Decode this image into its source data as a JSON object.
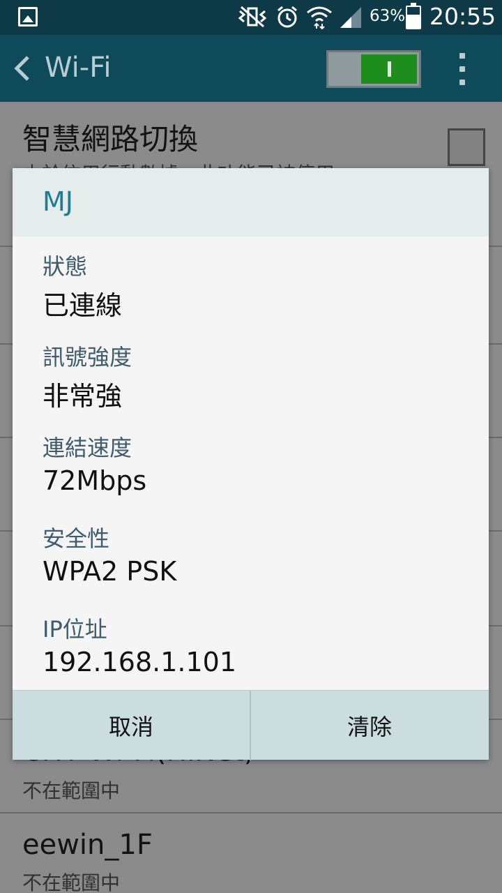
{
  "status_bar": {
    "gallery_icon": "picture-icon",
    "mute_icon": "vibrate-mute-icon",
    "alarm_icon": "alarm-clock-icon",
    "wifi_icon": "wifi-transfer-icon",
    "signal_icon": "cell-signal-icon",
    "battery_percent": "63%",
    "battery_level": 0.63,
    "time": "20:55"
  },
  "action_bar": {
    "back_icon": "chevron-left-icon",
    "title": "Wi-Fi",
    "wifi_enabled": true,
    "more_icon": "more-vert-icon"
  },
  "background_list": {
    "smart_switch_title": "智慧網路切換",
    "smart_switch_desc": "由於信用行動數據，此功能已被停用",
    "smart_switch_checked": false,
    "networks": [
      {
        "name": "CHT Wi-Fi(HiNet)",
        "status": "不在範圍中"
      },
      {
        "name": "eewin_1F",
        "status": "不在範圍中"
      }
    ]
  },
  "dialog": {
    "title": "MJ",
    "fields": [
      {
        "label": "狀態",
        "value": "已連線"
      },
      {
        "label": "訊號強度",
        "value": "非常強"
      },
      {
        "label": "連結速度",
        "value": "72Mbps"
      },
      {
        "label": "安全性",
        "value": "WPA2 PSK"
      },
      {
        "label": "IP位址",
        "value": "192.168.1.101"
      }
    ],
    "cancel_label": "取消",
    "clear_label": "清除"
  },
  "colors": {
    "status_bar": "#0e3a47",
    "action_bar": "#0e4a5a",
    "dialog_title": "#1b7f90",
    "switch_on": "#1d8e1d",
    "button_bar": "#ccdde0"
  }
}
